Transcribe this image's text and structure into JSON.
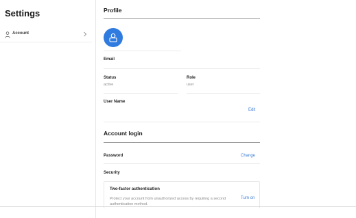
{
  "sidebar": {
    "title": "Settings",
    "items": [
      {
        "label": "Account",
        "icon": "person-icon"
      }
    ]
  },
  "profile": {
    "title": "Profile",
    "avatar_icon": "avatar-icon",
    "accent_color": "#2f7be0",
    "email_label": "Email",
    "status_label": "Status",
    "status_value": "active",
    "role_label": "Role",
    "role_value": "user",
    "username_label": "User Name",
    "edit_label": "Edit"
  },
  "account_login": {
    "title": "Account login",
    "password_label": "Password",
    "change_label": "Change",
    "security_label": "Security",
    "two_factor": {
      "title": "Two-factor authentication",
      "description": "Protect your account from unauthorized access by requiring a second authentication method.",
      "action_label": "Turn on"
    }
  }
}
